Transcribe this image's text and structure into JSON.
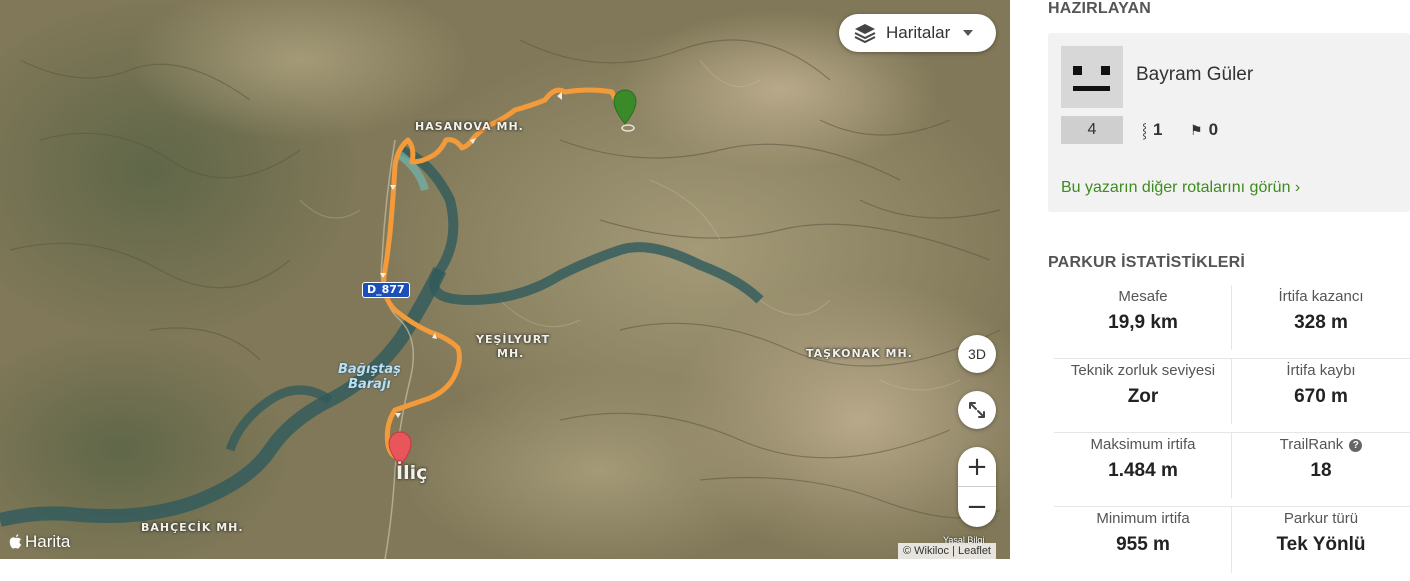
{
  "map": {
    "layers_button_label": "Haritalar",
    "btn_3d_label": "3D",
    "zoom_in_label": "+",
    "zoom_out_label": "−",
    "provider_label": "Harita",
    "legal_label": "Yasal Bilgi",
    "attribution": "© Wikiloc | Leaflet",
    "road_shield": "D_877",
    "labels": {
      "hasanova": "HASANOVA MH.",
      "yesilyurt_1": "YEŞİLYURT",
      "yesilyurt_2": "MH.",
      "taskonak": "TAŞKONAK MH.",
      "bahcecik": "BAHÇECİK MH.",
      "dam_1": "Bağıştaş",
      "dam_2": "Barajı",
      "town": "İliç"
    },
    "colors": {
      "route": "#f39a3b",
      "start_marker": "#3b8a2a",
      "end_marker": "#e8555a"
    }
  },
  "author": {
    "section_title": "HAZIRLAYAN",
    "name": "Bayram Güler",
    "trail_count": "4",
    "followers": "1",
    "following": "0",
    "more_link": "Bu yazarın diğer rotalarını görün ›"
  },
  "stats": {
    "section_title": "PARKUR İSTATİSTİKLERİ",
    "distance_label": "Mesafe",
    "distance": "19,9 km",
    "elev_gain_label": "İrtifa kazancı",
    "elev_gain": "328 m",
    "difficulty_label": "Teknik zorluk seviyesi",
    "difficulty": "Zor",
    "elev_loss_label": "İrtifa kaybı",
    "elev_loss": "670 m",
    "max_elev_label": "Maksimum irtifa",
    "max_elev": "1.484 m",
    "trailrank_label": "TrailRank",
    "trailrank": "18",
    "min_elev_label": "Minimum irtifa",
    "min_elev": "955 m",
    "trail_type_label": "Parkur türü",
    "trail_type": "Tek Yönlü"
  }
}
